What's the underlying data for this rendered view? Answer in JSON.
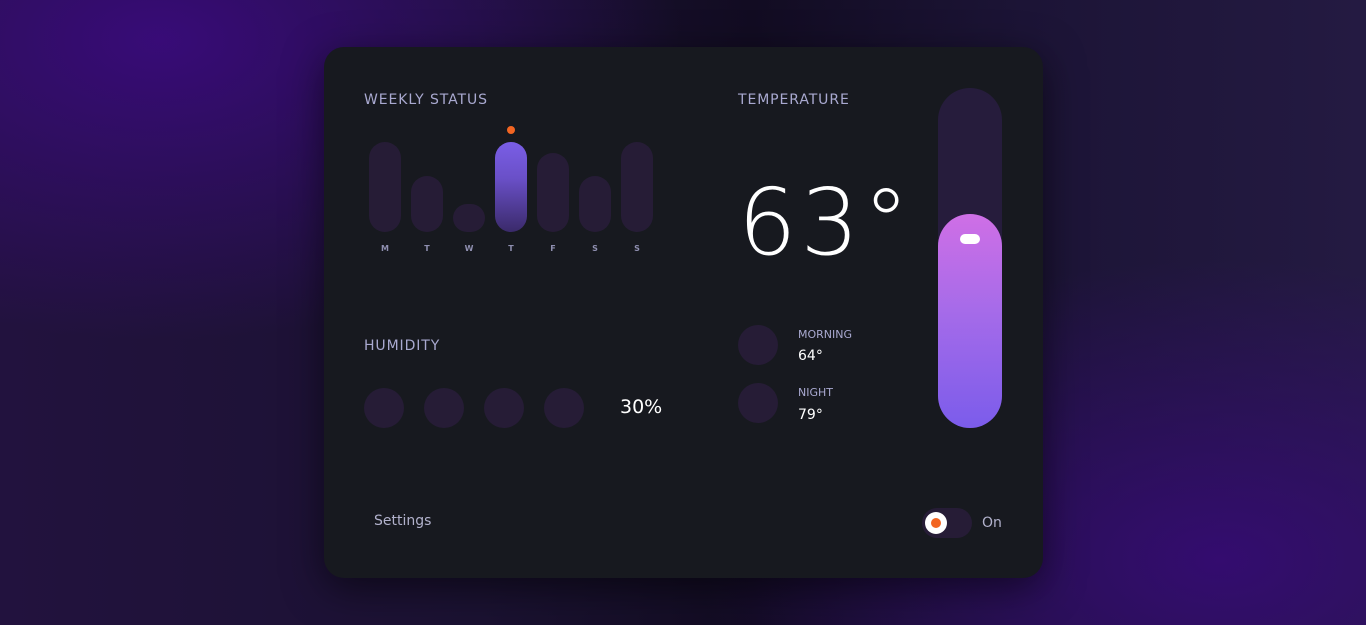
{
  "weekly": {
    "title": "WEEKLY STATUS",
    "days": [
      "M",
      "T",
      "W",
      "T",
      "F",
      "S",
      "S"
    ],
    "levels": [
      1.0,
      0.62,
      0.31,
      1.0,
      0.88,
      0.62,
      1.0
    ],
    "active_index": 3
  },
  "humidity": {
    "title": "HUMIDITY",
    "value": "30%"
  },
  "temperature": {
    "title": "TEMPERATURE",
    "current": "63°",
    "morning_label": "MORNING",
    "morning_value": "64°",
    "night_label": "NIGHT",
    "night_value": "79°",
    "slider_level": 0.63
  },
  "footer": {
    "settings_label": "Settings",
    "toggle_label": "On",
    "toggle_on": true
  },
  "colors": {
    "accent_orange": "#f26522",
    "accent_purple": "#7a5ee6",
    "card_bg": "#17191f"
  }
}
